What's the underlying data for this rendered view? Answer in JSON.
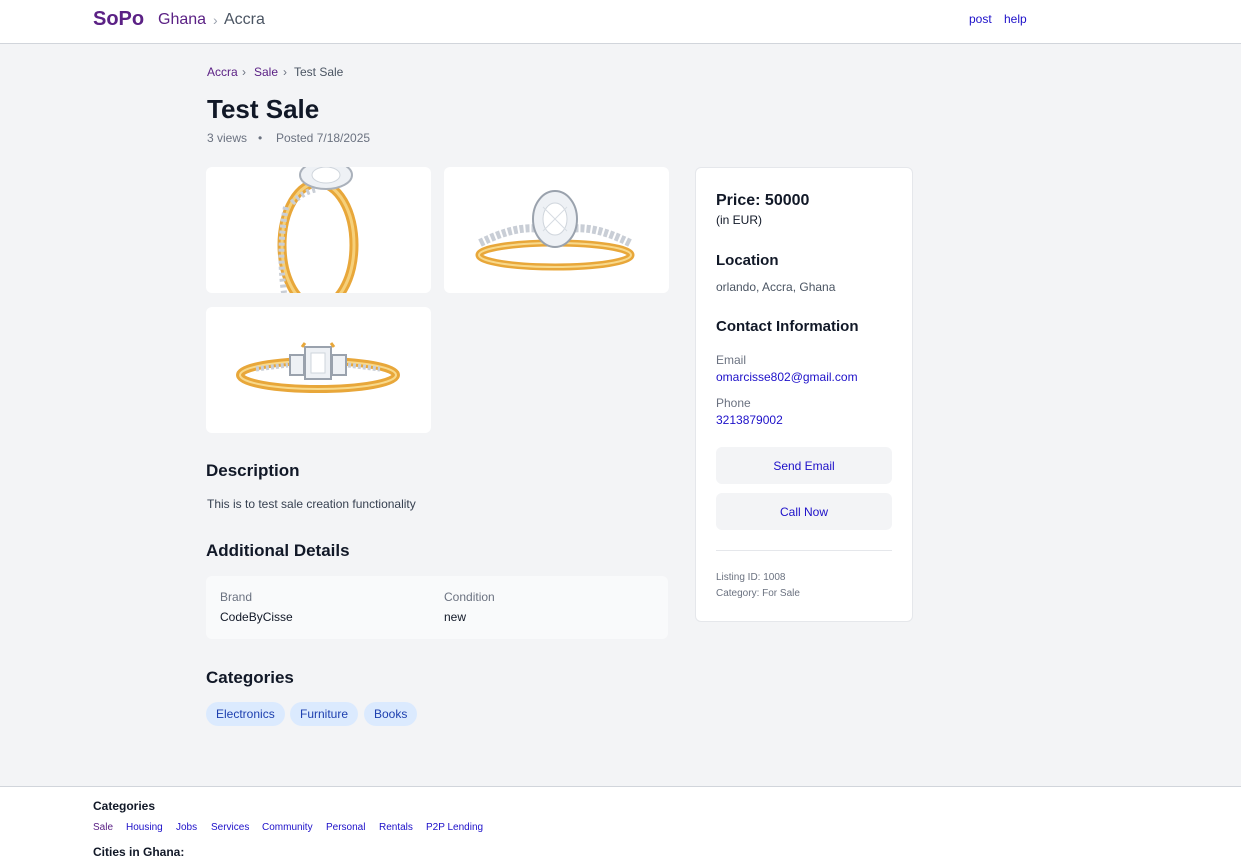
{
  "header": {
    "brand": "SoPo",
    "country": "Ghana",
    "separator": "›",
    "city": "Accra",
    "nav": {
      "post": "post",
      "help": "help"
    }
  },
  "breadcrumb": {
    "items": [
      "Accra",
      "Sale",
      "Test Sale"
    ],
    "separator": "›"
  },
  "listing": {
    "title": "Test Sale",
    "views": "3 views",
    "dot": "•",
    "posted": "Posted 7/18/2025",
    "description_heading": "Description",
    "description": "This is to test sale creation functionality",
    "details_heading": "Additional Details",
    "details": [
      {
        "key": "Brand",
        "value": "CodeByCisse"
      },
      {
        "key": "Condition",
        "value": "new"
      }
    ],
    "categories_heading": "Categories",
    "categories": [
      "Electronics",
      "Furniture",
      "Books"
    ]
  },
  "sidebar": {
    "price": "Price: 50000",
    "currency_note": "(in EUR)",
    "location_heading": "Location",
    "location": "orlando, Accra, Ghana",
    "contact_heading": "Contact Information",
    "email_label": "Email",
    "email": "omarcisse802@gmail.com",
    "phone_label": "Phone",
    "phone": "3213879002",
    "send_email": "Send Email",
    "call_now": "Call Now",
    "listing_id": "Listing ID: 1008",
    "category": "Category: For Sale"
  },
  "footer": {
    "categories_heading": "Categories",
    "links": [
      "Sale",
      "Housing",
      "Jobs",
      "Services",
      "Community",
      "Personal",
      "Rentals",
      "P2P Lending"
    ],
    "cities_heading": "Cities in Ghana:"
  },
  "colors": {
    "brand": "#5b2185",
    "link": "#1d10c9",
    "gold": "#e8a73a",
    "chip_bg": "#dbeafe"
  }
}
